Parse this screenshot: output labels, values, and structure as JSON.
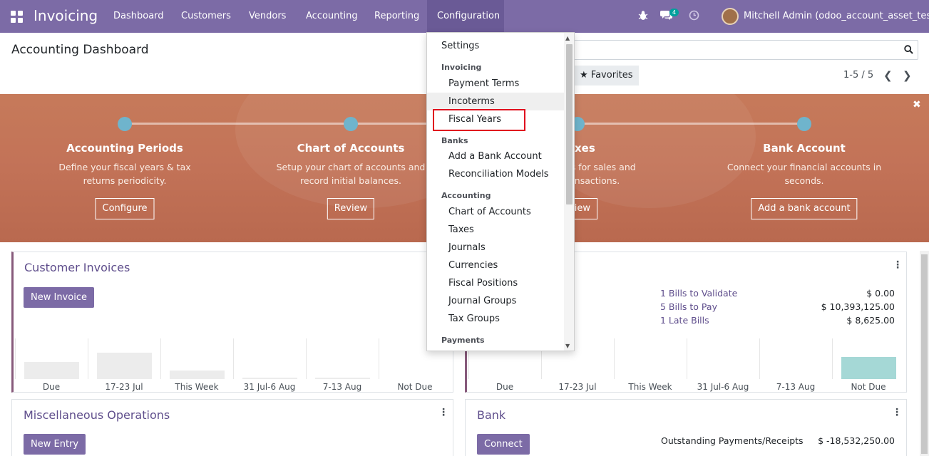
{
  "navbar": {
    "app_name": "Invoicing",
    "menus": [
      {
        "label": "Dashboard"
      },
      {
        "label": "Customers"
      },
      {
        "label": "Vendors"
      },
      {
        "label": "Accounting"
      },
      {
        "label": "Reporting"
      },
      {
        "label": "Configuration"
      }
    ],
    "chat_count": "4",
    "user_name": "Mitchell Admin (odoo_account_asset_test)"
  },
  "control_panel": {
    "title": "Accounting Dashboard",
    "favorites_label": "Favorites",
    "pager": "1-5 / 5"
  },
  "onboarding": {
    "steps": [
      {
        "title": "Accounting Periods",
        "desc_1": "Define your fiscal years & tax",
        "desc_2": "returns periodicity.",
        "button": "Configure"
      },
      {
        "title": "Chart of Accounts",
        "desc_1": "Setup your chart of accounts and",
        "desc_2": "record initial balances.",
        "button": "Review"
      },
      {
        "title": "xes",
        "desc_1": "es for sales and",
        "desc_2": "ransactions.",
        "button": "view"
      },
      {
        "title": "Bank Account",
        "desc_1": "Connect your financial accounts in",
        "desc_2": "seconds.",
        "button": "Add a bank account"
      }
    ]
  },
  "cards": {
    "customer_invoices": {
      "title": "Customer Invoices",
      "button": "New Invoice",
      "chart_labels": [
        "Due",
        "17-23 Jul",
        "This Week",
        "31 Jul-6 Aug",
        "7-13 Aug",
        "Not Due"
      ]
    },
    "vendor_bills": {
      "rows": [
        {
          "label": "1 Bills to Validate",
          "amount": "$ 0.00"
        },
        {
          "label": "5 Bills to Pay",
          "amount": "$ 10,393,125.00"
        },
        {
          "label": "1 Late Bills",
          "amount": "$ 8,625.00"
        }
      ],
      "chart_labels": [
        "Due",
        "17-23 Jul",
        "This Week",
        "31 Jul-6 Aug",
        "7-13 Aug",
        "Not Due"
      ]
    },
    "misc_operations": {
      "title": "Miscellaneous Operations",
      "button": "New Entry"
    },
    "bank": {
      "title": "Bank",
      "button": "Connect",
      "row_label": "Outstanding Payments/Receipts",
      "row_amount": "$ -18,532,250.00"
    }
  },
  "config_menu": {
    "settings": "Settings",
    "sections": {
      "invoicing": "Invoicing",
      "banks": "Banks",
      "accounting": "Accounting",
      "payments": "Payments"
    },
    "invoicing_items": [
      "Payment Terms",
      "Incoterms",
      "Fiscal Years"
    ],
    "banks_items": [
      "Add a Bank Account",
      "Reconciliation Models"
    ],
    "accounting_items": [
      "Chart of Accounts",
      "Taxes",
      "Journals",
      "Currencies",
      "Fiscal Positions",
      "Journal Groups",
      "Tax Groups"
    ]
  }
}
